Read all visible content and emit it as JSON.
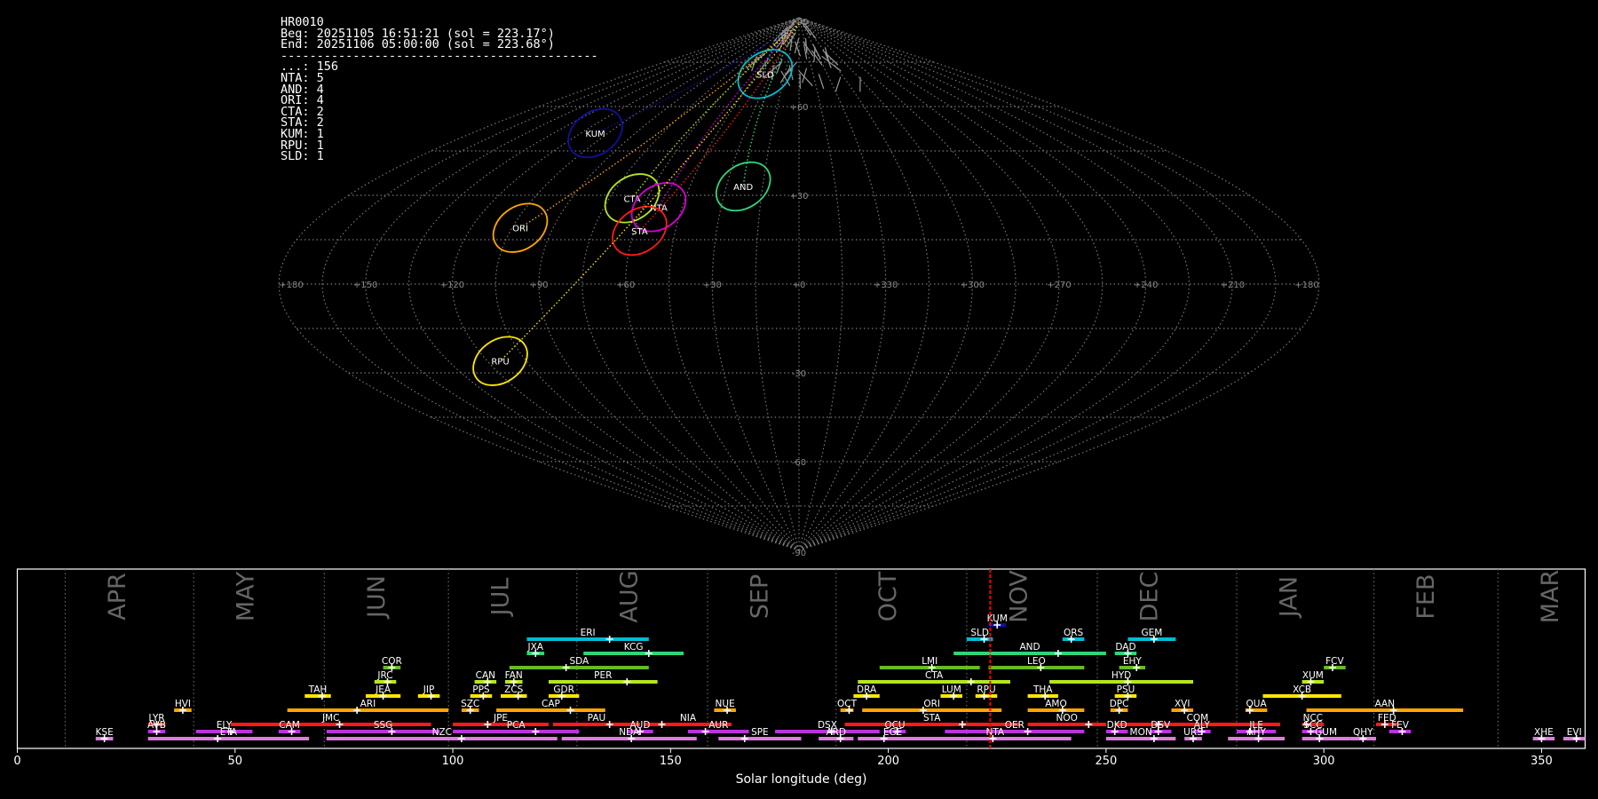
{
  "info": {
    "camera": "HR0010",
    "beg": "Beg: 20251105 16:51:21 (sol = 223.17°)",
    "end": "End: 20251106 05:00:00 (sol = 223.68°)",
    "separator": "--------------------------------------------",
    "counts": [
      {
        "code": "...",
        "n": 156
      },
      {
        "code": "NTA",
        "n": 5
      },
      {
        "code": "AND",
        "n": 4
      },
      {
        "code": "ORI",
        "n": 4
      },
      {
        "code": "CTA",
        "n": 2
      },
      {
        "code": "STA",
        "n": 2
      },
      {
        "code": "KUM",
        "n": 1
      },
      {
        "code": "RPU",
        "n": 1
      },
      {
        "code": "SLD",
        "n": 1
      }
    ]
  },
  "chart_data": [
    {
      "type": "scatter",
      "projection": "sinusoidal",
      "lon_labels": [
        "+180",
        "+150",
        "+120",
        "+90",
        "+60",
        "+30",
        "+0",
        "+330",
        "+300",
        "+270",
        "+240",
        "+210",
        "+180"
      ],
      "lat_labels": [
        "+90",
        "+60",
        "+30",
        "-30",
        "-60",
        "-90"
      ],
      "radiants": [
        {
          "code": "SLD",
          "lon": 36,
          "lat": 71,
          "color": "#00bcd4"
        },
        {
          "code": "KUM",
          "lon": 112,
          "lat": 51,
          "color": "#1010a0"
        },
        {
          "code": "CTA",
          "lon": 66,
          "lat": 29,
          "color": "#b5e61d"
        },
        {
          "code": "ORI",
          "lon": 102,
          "lat": 19,
          "color": "#ffa500"
        },
        {
          "code": "NTA",
          "lon": 54,
          "lat": 26,
          "color": "#d400d4"
        },
        {
          "code": "STA",
          "lon": 58,
          "lat": 18,
          "color": "#ff1a1a"
        },
        {
          "code": "AND",
          "lon": 23,
          "lat": 33,
          "color": "#2ed57a"
        },
        {
          "code": "RPU",
          "lon": 115,
          "lat": -26,
          "color": "#ffe600"
        }
      ]
    },
    {
      "type": "timeline",
      "xlabel": "Solar longitude (deg)",
      "xlim": [
        0,
        360
      ],
      "xticks": [
        0,
        50,
        100,
        150,
        200,
        250,
        300,
        350
      ],
      "current_sol": 223.4,
      "months": [
        {
          "label": "APR",
          "start": 11
        },
        {
          "label": "MAY",
          "start": 40.5
        },
        {
          "label": "JUN",
          "start": 70.5
        },
        {
          "label": "JUL",
          "start": 99
        },
        {
          "label": "AUG",
          "start": 128.5
        },
        {
          "label": "SEP",
          "start": 158.5
        },
        {
          "label": "OCT",
          "start": 188
        },
        {
          "label": "NOV",
          "start": 218
        },
        {
          "label": "DEC",
          "start": 248
        },
        {
          "label": "JAN",
          "start": 280
        },
        {
          "label": "FEB",
          "start": 311.5
        },
        {
          "label": "MAR",
          "start": 340
        }
      ],
      "showers": [
        {
          "code": "KUM",
          "start": 223,
          "end": 227,
          "peak": 225,
          "row": 8,
          "color": "#1010a0"
        },
        {
          "code": "ERI",
          "start": 117,
          "end": 145,
          "peak": 136,
          "row": 7,
          "color": "#00bcd4"
        },
        {
          "code": "SLD",
          "start": 218,
          "end": 224,
          "peak": 222,
          "row": 7,
          "color": "#00bcd4"
        },
        {
          "code": "ORS",
          "start": 240,
          "end": 245,
          "peak": 242,
          "row": 7,
          "color": "#00bcd4"
        },
        {
          "code": "GEM",
          "start": 255,
          "end": 266,
          "peak": 261,
          "row": 7,
          "color": "#00bcd4"
        },
        {
          "code": "JXA",
          "start": 117,
          "end": 121,
          "peak": 119,
          "row": 6,
          "color": "#2ed57a"
        },
        {
          "code": "KCG",
          "start": 130,
          "end": 153,
          "peak": 145,
          "row": 6,
          "color": "#2ed57a"
        },
        {
          "code": "AND",
          "start": 215,
          "end": 250,
          "peak": 239,
          "row": 6,
          "color": "#2ed57a"
        },
        {
          "code": "DAD",
          "start": 252,
          "end": 257,
          "peak": 255,
          "row": 6,
          "color": "#2ed57a"
        },
        {
          "code": "COR",
          "start": 84,
          "end": 88,
          "peak": 86,
          "row": 5,
          "color": "#66bb22"
        },
        {
          "code": "SDA",
          "start": 113,
          "end": 145,
          "peak": 126,
          "row": 5,
          "color": "#66bb22"
        },
        {
          "code": "LMI",
          "start": 198,
          "end": 221,
          "peak": 210,
          "row": 5,
          "color": "#66bb22"
        },
        {
          "code": "LEO",
          "start": 223,
          "end": 245,
          "peak": 235,
          "row": 5,
          "color": "#66bb22"
        },
        {
          "code": "EHY",
          "start": 253,
          "end": 259,
          "peak": 257,
          "row": 5,
          "color": "#66bb22"
        },
        {
          "code": "FCV",
          "start": 300,
          "end": 305,
          "peak": 302,
          "row": 5,
          "color": "#66bb22"
        },
        {
          "code": "JRC",
          "start": 82,
          "end": 87,
          "peak": 85,
          "row": 4,
          "color": "#b5e61d"
        },
        {
          "code": "CAN",
          "start": 105,
          "end": 110,
          "peak": 108,
          "row": 4,
          "color": "#b5e61d"
        },
        {
          "code": "FAN",
          "start": 112,
          "end": 116,
          "peak": 114,
          "row": 4,
          "color": "#b5e61d"
        },
        {
          "code": "PER",
          "start": 122,
          "end": 147,
          "peak": 140,
          "row": 4,
          "color": "#b5e61d"
        },
        {
          "code": "CTA",
          "start": 193,
          "end": 228,
          "peak": 219,
          "row": 4,
          "color": "#b5e61d"
        },
        {
          "code": "HYD",
          "start": 237,
          "end": 270,
          "peak": 255,
          "row": 4,
          "color": "#b5e61d"
        },
        {
          "code": "XUM",
          "start": 295,
          "end": 300,
          "peak": 297,
          "row": 4,
          "color": "#b5e61d"
        },
        {
          "code": "TAH",
          "start": 66,
          "end": 72,
          "peak": 70,
          "row": 3,
          "color": "#ffe600"
        },
        {
          "code": "JEA",
          "start": 80,
          "end": 88,
          "peak": 84,
          "row": 3,
          "color": "#ffe600"
        },
        {
          "code": "JIP",
          "start": 92,
          "end": 97,
          "peak": 95,
          "row": 3,
          "color": "#ffe600"
        },
        {
          "code": "PPS",
          "start": 104,
          "end": 109,
          "peak": 107,
          "row": 3,
          "color": "#ffe600"
        },
        {
          "code": "ZCS",
          "start": 111,
          "end": 117,
          "peak": 115,
          "row": 3,
          "color": "#ffe600"
        },
        {
          "code": "GDR",
          "start": 122,
          "end": 129,
          "peak": 125,
          "row": 3,
          "color": "#ffe600"
        },
        {
          "code": "DRA",
          "start": 192,
          "end": 198,
          "peak": 195,
          "row": 3,
          "color": "#ffe600"
        },
        {
          "code": "LUM",
          "start": 212,
          "end": 217,
          "peak": 215,
          "row": 3,
          "color": "#ffe600"
        },
        {
          "code": "RPU",
          "start": 220,
          "end": 225,
          "peak": 222,
          "row": 3,
          "color": "#ffe600"
        },
        {
          "code": "THA",
          "start": 232,
          "end": 239,
          "peak": 236,
          "row": 3,
          "color": "#ffe600"
        },
        {
          "code": "PSU",
          "start": 252,
          "end": 257,
          "peak": 255,
          "row": 3,
          "color": "#ffe600"
        },
        {
          "code": "XCB",
          "start": 286,
          "end": 304,
          "peak": 295,
          "row": 3,
          "color": "#ffe600"
        },
        {
          "code": "HVI",
          "start": 36,
          "end": 40,
          "peak": 38,
          "row": 2,
          "color": "#ffa500"
        },
        {
          "code": "ARI",
          "start": 62,
          "end": 99,
          "peak": 78,
          "row": 2,
          "color": "#ffa500"
        },
        {
          "code": "SZC",
          "start": 102,
          "end": 106,
          "peak": 104,
          "row": 2,
          "color": "#ffa500"
        },
        {
          "code": "CAP",
          "start": 110,
          "end": 135,
          "peak": 127,
          "row": 2,
          "color": "#ffa500"
        },
        {
          "code": "NUE",
          "start": 160,
          "end": 165,
          "peak": 163,
          "row": 2,
          "color": "#ffa500"
        },
        {
          "code": "OCT",
          "start": 189,
          "end": 192,
          "peak": 191,
          "row": 2,
          "color": "#ffa500"
        },
        {
          "code": "ORI",
          "start": 194,
          "end": 226,
          "peak": 208,
          "row": 2,
          "color": "#ffa500"
        },
        {
          "code": "AMO",
          "start": 232,
          "end": 245,
          "peak": 240,
          "row": 2,
          "color": "#ffa500"
        },
        {
          "code": "DPC",
          "start": 251,
          "end": 255,
          "peak": 253,
          "row": 2,
          "color": "#ffa500"
        },
        {
          "code": "XVI",
          "start": 265,
          "end": 270,
          "peak": 268,
          "row": 2,
          "color": "#ffa500"
        },
        {
          "code": "QUA",
          "start": 282,
          "end": 287,
          "peak": 283,
          "row": 2,
          "color": "#ffa500"
        },
        {
          "code": "AAN",
          "start": 296,
          "end": 332,
          "peak": 316,
          "row": 2,
          "color": "#ffa500"
        },
        {
          "code": "LYR",
          "start": 30,
          "end": 34,
          "peak": 32,
          "row": 1,
          "color": "#ff1a1a"
        },
        {
          "code": "JMC",
          "start": 49,
          "end": 95,
          "peak": 74,
          "row": 1,
          "color": "#ff1a1a"
        },
        {
          "code": "JPE",
          "start": 100,
          "end": 122,
          "peak": 108,
          "row": 1,
          "color": "#ff1a1a"
        },
        {
          "code": "PAU",
          "start": 123,
          "end": 143,
          "peak": 136,
          "row": 1,
          "color": "#ff1a1a"
        },
        {
          "code": "NIA",
          "start": 144,
          "end": 164,
          "peak": 148,
          "row": 1,
          "color": "#ff1a1a"
        },
        {
          "code": "STA",
          "start": 190,
          "end": 230,
          "peak": 217,
          "row": 1,
          "color": "#ff1a1a"
        },
        {
          "code": "NOO",
          "start": 232,
          "end": 250,
          "peak": 246,
          "row": 1,
          "color": "#ff1a1a"
        },
        {
          "code": "COM",
          "start": 252,
          "end": 290,
          "peak": 262,
          "row": 1,
          "color": "#ff1a1a"
        },
        {
          "code": "NCC",
          "start": 295,
          "end": 300,
          "peak": 296,
          "row": 1,
          "color": "#ff1a1a"
        },
        {
          "code": "FED",
          "start": 312,
          "end": 317,
          "peak": 314,
          "row": 1,
          "color": "#ff1a1a"
        },
        {
          "code": "AVB",
          "start": 30,
          "end": 34,
          "peak": 32,
          "row": 0.5,
          "color": "#bb33dd"
        },
        {
          "code": "ELY",
          "start": 41,
          "end": 54,
          "peak": 49,
          "row": 0.5,
          "color": "#bb33dd"
        },
        {
          "code": "CAM",
          "start": 60,
          "end": 65,
          "peak": 63,
          "row": 0.5,
          "color": "#bb33dd"
        },
        {
          "code": "SSG",
          "start": 71,
          "end": 97,
          "peak": 86,
          "row": 0.5,
          "color": "#bb33dd"
        },
        {
          "code": "PCA",
          "start": 100,
          "end": 129,
          "peak": 119,
          "row": 0.5,
          "color": "#bb33dd"
        },
        {
          "code": "AUD",
          "start": 140,
          "end": 146,
          "peak": 143,
          "row": 0.5,
          "color": "#bb33dd"
        },
        {
          "code": "AUR",
          "start": 154,
          "end": 168,
          "peak": 158,
          "row": 0.5,
          "color": "#bb33dd"
        },
        {
          "code": "DSX",
          "start": 174,
          "end": 198,
          "peak": 187,
          "row": 0.5,
          "color": "#bb33dd"
        },
        {
          "code": "OCU",
          "start": 199,
          "end": 204,
          "peak": 202,
          "row": 0.5,
          "color": "#bb33dd"
        },
        {
          "code": "OER",
          "start": 213,
          "end": 245,
          "peak": 232,
          "row": 0.5,
          "color": "#bb33dd"
        },
        {
          "code": "DKD",
          "start": 250,
          "end": 255,
          "peak": 252,
          "row": 0.5,
          "color": "#bb33dd"
        },
        {
          "code": "DSV",
          "start": 260,
          "end": 265,
          "peak": 262,
          "row": 0.5,
          "color": "#bb33dd"
        },
        {
          "code": "ALY",
          "start": 270,
          "end": 274,
          "peak": 272,
          "row": 0.5,
          "color": "#bb33dd"
        },
        {
          "code": "JLE",
          "start": 280,
          "end": 289,
          "peak": 283,
          "row": 0.5,
          "color": "#bb33dd"
        },
        {
          "code": "SCC",
          "start": 295,
          "end": 300,
          "peak": 297,
          "row": 0.5,
          "color": "#bb33dd"
        },
        {
          "code": "FEV",
          "start": 315,
          "end": 320,
          "peak": 318,
          "row": 0.5,
          "color": "#bb33dd"
        },
        {
          "code": "KSE",
          "start": 18,
          "end": 22,
          "peak": 20,
          "row": 0,
          "color": "#e07be0"
        },
        {
          "code": "ETA",
          "start": 30,
          "end": 67,
          "peak": 46,
          "row": 0,
          "color": "#e07be0"
        },
        {
          "code": "NZC",
          "start": 71,
          "end": 124,
          "peak": 102,
          "row": 0,
          "color": "#e07be0"
        },
        {
          "code": "NDA",
          "start": 125,
          "end": 156,
          "peak": 141,
          "row": 0,
          "color": "#e07be0"
        },
        {
          "code": "SPE",
          "start": 161,
          "end": 180,
          "peak": 167,
          "row": 0,
          "color": "#e07be0"
        },
        {
          "code": "ARD",
          "start": 184,
          "end": 192,
          "peak": 189,
          "row": 0,
          "color": "#e07be0"
        },
        {
          "code": "EGE",
          "start": 193,
          "end": 209,
          "peak": 199,
          "row": 0,
          "color": "#e07be0"
        },
        {
          "code": "NTA",
          "start": 207,
          "end": 242,
          "peak": 224,
          "row": 0,
          "color": "#e07be0"
        },
        {
          "code": "MON",
          "start": 250,
          "end": 266,
          "peak": 261,
          "row": 0,
          "color": "#e07be0"
        },
        {
          "code": "URS",
          "start": 268,
          "end": 272,
          "peak": 270,
          "row": 0,
          "color": "#e07be0"
        },
        {
          "code": "AHY",
          "start": 278,
          "end": 291,
          "peak": 285,
          "row": 0,
          "color": "#e07be0"
        },
        {
          "code": "GUM",
          "start": 295,
          "end": 306,
          "peak": 299,
          "row": 0,
          "color": "#e07be0"
        },
        {
          "code": "QHY",
          "start": 306,
          "end": 312,
          "peak": 309,
          "row": 0,
          "color": "#e07be0"
        },
        {
          "code": "XHE",
          "start": 348,
          "end": 353,
          "peak": 350,
          "row": 0,
          "color": "#e07be0"
        },
        {
          "code": "EVI",
          "start": 355,
          "end": 360,
          "peak": 358,
          "row": 0,
          "color": "#e07be0"
        }
      ]
    }
  ]
}
